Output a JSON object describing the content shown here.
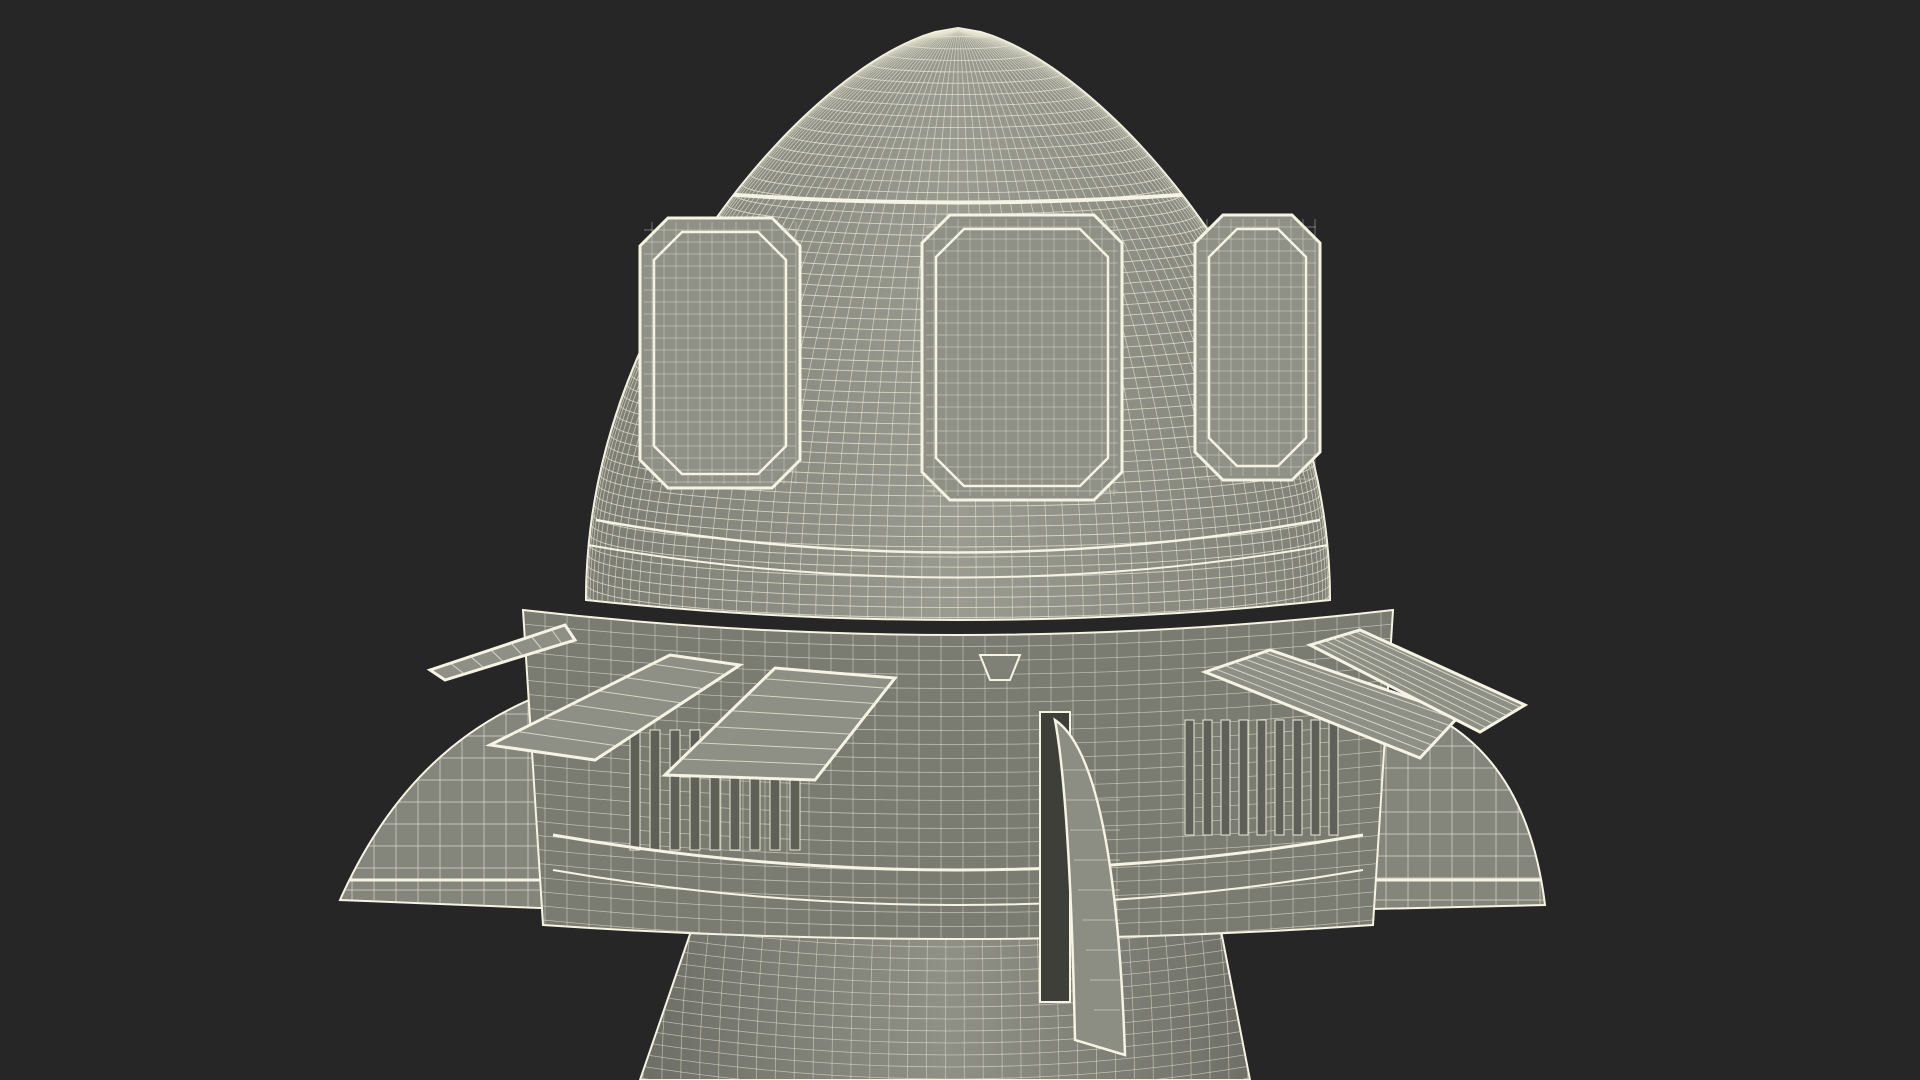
{
  "render": {
    "subject": "capsule-wireframe",
    "colors": {
      "background": "#262626",
      "surface": "#8a8b80",
      "surface_dark": "#76776d",
      "surface_light": "#9c9d92",
      "wire": "#e9e8d6",
      "edge": "#f4f3e4",
      "shadow": "#5f6058"
    }
  }
}
